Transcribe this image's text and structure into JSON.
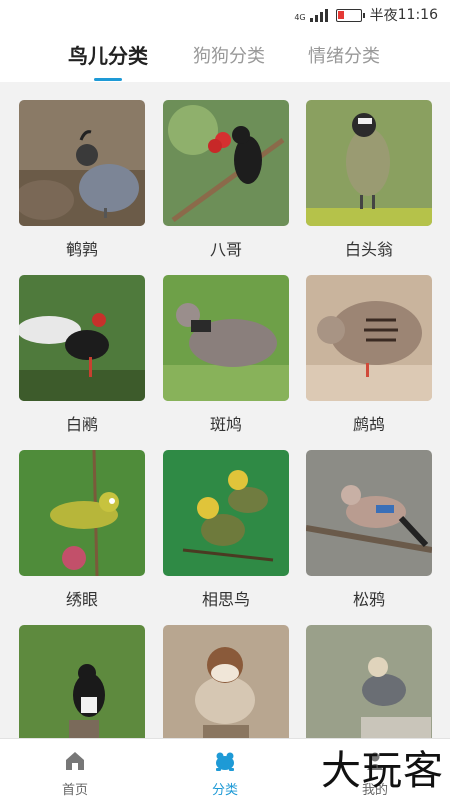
{
  "status": {
    "network": "4G",
    "time_prefix": "半夜",
    "time": "11:16"
  },
  "tabs": [
    {
      "label": "鸟儿分类",
      "active": true
    },
    {
      "label": "狗狗分类",
      "active": false
    },
    {
      "label": "情绪分类",
      "active": false
    }
  ],
  "birds": [
    {
      "name": "鹌鹑"
    },
    {
      "name": "八哥"
    },
    {
      "name": "白头翁"
    },
    {
      "name": "白鹇"
    },
    {
      "name": "斑鸠"
    },
    {
      "name": "鹧鸪"
    },
    {
      "name": "绣眼"
    },
    {
      "name": "相思鸟"
    },
    {
      "name": "松鸦"
    },
    {
      "name": ""
    },
    {
      "name": ""
    },
    {
      "name": ""
    }
  ],
  "bottom_nav": [
    {
      "label": "首页",
      "icon": "home-icon",
      "active": false
    },
    {
      "label": "分类",
      "icon": "frog-icon",
      "active": true
    },
    {
      "label": "我的",
      "icon": "profile-icon",
      "active": false
    }
  ],
  "watermark": "大玩客",
  "colors": {
    "accent": "#1e9ad6",
    "battery": "#e53935"
  }
}
